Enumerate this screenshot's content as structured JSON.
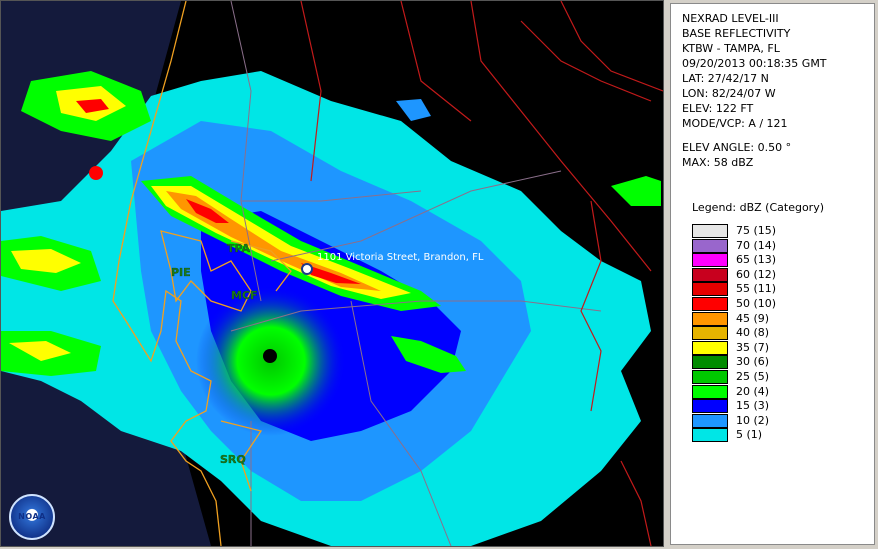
{
  "info": {
    "product": "NEXRAD LEVEL-III",
    "type": "BASE REFLECTIVITY",
    "station": "KTBW - TAMPA, FL",
    "datetime": "09/20/2013 00:18:35 GMT",
    "lat": "LAT: 27/42/17 N",
    "lon": "LON: 82/24/07 W",
    "elev": "ELEV: 122 FT",
    "mode": "MODE/VCP: A / 121",
    "elev_angle": "ELEV ANGLE: 0.50 °",
    "max": "MAX: 58 dBZ"
  },
  "legend": {
    "title": "Legend: dBZ (Category)",
    "items": [
      {
        "label": "75  (15)",
        "color": "#e6e6e6"
      },
      {
        "label": "70  (14)",
        "color": "#9966cc"
      },
      {
        "label": "65  (13)",
        "color": "#ff00ff"
      },
      {
        "label": "60  (12)",
        "color": "#c8001e"
      },
      {
        "label": "55  (11)",
        "color": "#e60000"
      },
      {
        "label": "50  (10)",
        "color": "#ff0000"
      },
      {
        "label": "45  (9)",
        "color": "#ff9600"
      },
      {
        "label": "40  (8)",
        "color": "#e6b400"
      },
      {
        "label": "35  (7)",
        "color": "#ffff00"
      },
      {
        "label": "30  (6)",
        "color": "#008c00"
      },
      {
        "label": "25  (5)",
        "color": "#00c800"
      },
      {
        "label": "20  (4)",
        "color": "#00ff00"
      },
      {
        "label": "15  (3)",
        "color": "#0000ff"
      },
      {
        "label": "10  (2)",
        "color": "#1e96ff"
      },
      {
        "label": "5  (1)",
        "color": "#00e6e6"
      }
    ]
  },
  "map": {
    "cities": [
      "TPA",
      "PIE",
      "MCF",
      "SRQ"
    ],
    "location_label": "1101 Victoria Street, Brandon, FL",
    "logo_text": "NOAA"
  }
}
